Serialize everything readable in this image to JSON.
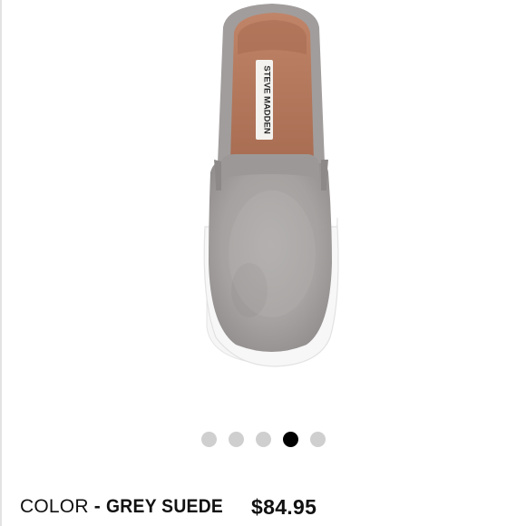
{
  "product": {
    "brand_label": "STEVE MADDEN",
    "color_label": "COLOR",
    "separator": "-",
    "color_value": "GREY SUEDE",
    "price": "$84.95"
  },
  "carousel": {
    "total": 5,
    "active_index": 3,
    "dots": [
      {
        "name": "carousel-dot-1",
        "active": false
      },
      {
        "name": "carousel-dot-2",
        "active": false
      },
      {
        "name": "carousel-dot-3",
        "active": false
      },
      {
        "name": "carousel-dot-4",
        "active": true
      },
      {
        "name": "carousel-dot-5",
        "active": false
      }
    ]
  },
  "colors": {
    "suede": "#a8a4a3",
    "lining": "#b87a5f",
    "dot_inactive": "#cfcfcf",
    "dot_active": "#000000"
  }
}
